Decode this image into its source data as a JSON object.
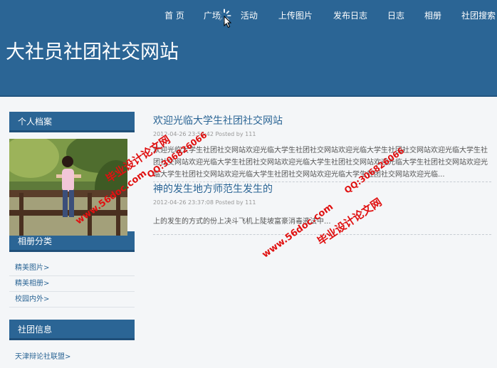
{
  "nav": {
    "items": [
      "首 页",
      "广场",
      "活动",
      "上传图片",
      "发布日志",
      "日志",
      "相册",
      "社团搜索"
    ]
  },
  "site": {
    "title": "大社员社团社交网站"
  },
  "sidebar": {
    "profile_header": "个人档案",
    "album_header": "相册分类",
    "albums": [
      "精美图片>",
      "精美相册>",
      "校园内外>"
    ],
    "club_header": "社团信息",
    "club_link": "天津辩论社联盟>"
  },
  "posts": [
    {
      "title": "欢迎光临大学生社团社交网站",
      "meta": "2012-04-26 23:52:42   Posted by 111",
      "body": "欢迎光临大学生社团社交网站欢迎光临大学生社团社交网站欢迎光临大学生社团社交网站欢迎光临大学生社团社交网站欢迎光临大学生社团社交网站欢迎光临大学生社团社交网站欢迎光临大学生社团社交网站欢迎光临大学生社团社交网站欢迎光临大学生社团社交网站欢迎光临大学生社团社交网站欢迎光临..."
    },
    {
      "title": "神的发生地方师范生发生的",
      "meta": "2012-04-26 23:37:08   Posted by 111",
      "body": "上的发生的方式的份上决斗飞机上陡坡富豪消毒液法中..."
    }
  ],
  "watermarks": {
    "site": "www.56doc.com",
    "qq": "QQ:306826066",
    "brand": "毕业设计论文网"
  },
  "colors": {
    "header_bg": "#2b6595",
    "link": "#2b6595",
    "watermark": "#e01010"
  }
}
